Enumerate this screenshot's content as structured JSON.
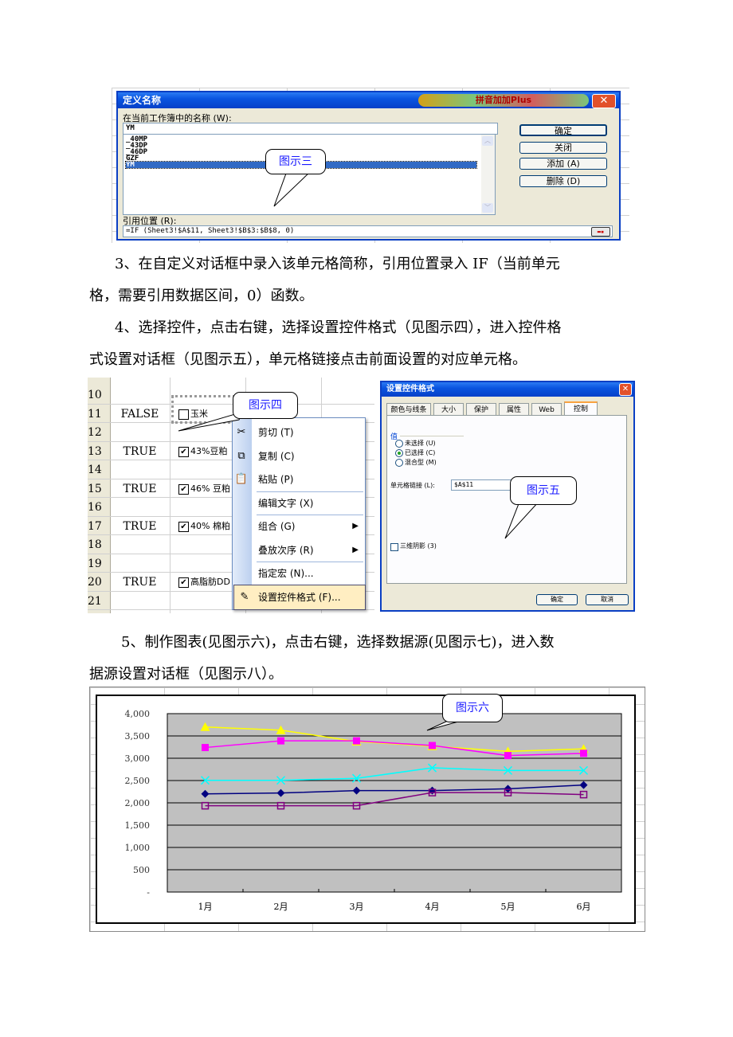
{
  "figure3_dialog": {
    "title": "定义名称",
    "title_logo": "拼音加加Plus",
    "close_icon": "close-icon",
    "names_label": "在当前工作簿中的名称 (W):",
    "name_input_value": "YM",
    "names_list": [
      "_40MP",
      "_43DP",
      "_46DP",
      "GZF",
      "YM"
    ],
    "selected_name": "YM",
    "buttons": {
      "ok": "确定",
      "close": "关闭",
      "add": "添加 (A)",
      "delete": "删除 (D)"
    },
    "refers_label": "引用位置 (R):",
    "refers_value": "=IF (Sheet3!$A$11, Sheet3!$B$3:$B$8, 0)",
    "collapse_icon": "range-select-icon",
    "callout": "图示三"
  },
  "paragraphs": {
    "p3_line1": "3、在自定义对话框中录入该单元格简称，引用位置录入 IF（当前单元",
    "p3_line2": "格，需要引用数据区间，0）函数。",
    "p4_line1": "4、选择控件，点击右键，选择设置控件格式（见图示四），进入控件格",
    "p4_line2": "式设置对话框（见图示五），单元格链接点击前面设置的对应单元格。",
    "p5_line1": "5、制作图表(见图示六)，点击右键，选择数据源(见图示七)，进入数",
    "p5_line2": "据源设置对话框（见图示八）。"
  },
  "figure4_sheet": {
    "rows": [
      {
        "num": "10",
        "a": "",
        "b": ""
      },
      {
        "num": "11",
        "a": "FALSE",
        "b": "玉米",
        "checked": false
      },
      {
        "num": "12",
        "a": "",
        "b": ""
      },
      {
        "num": "13",
        "a": "TRUE",
        "b": "43%豆粕",
        "checked": true
      },
      {
        "num": "14",
        "a": "",
        "b": ""
      },
      {
        "num": "15",
        "a": "TRUE",
        "b": "46% 豆粕",
        "checked": true
      },
      {
        "num": "16",
        "a": "",
        "b": ""
      },
      {
        "num": "17",
        "a": "TRUE",
        "b": "40% 棉粕",
        "checked": true
      },
      {
        "num": "18",
        "a": "",
        "b": ""
      },
      {
        "num": "19",
        "a": "",
        "b": ""
      },
      {
        "num": "20",
        "a": "TRUE",
        "b": "高脂肪DD",
        "checked": true
      },
      {
        "num": "21",
        "a": "",
        "b": ""
      }
    ],
    "callout": "图示四",
    "context_menu": [
      {
        "label": "剪切 (T)",
        "icon": "scissors-icon"
      },
      {
        "label": "复制 (C)",
        "icon": "copy-icon"
      },
      {
        "label": "粘贴 (P)",
        "icon": "paste-icon"
      },
      {
        "label": "编辑文字 (X)"
      },
      {
        "label": "组合 (G)",
        "submenu": true
      },
      {
        "label": "叠放次序 (R)",
        "submenu": true
      },
      {
        "label": "指定宏 (N)..."
      },
      {
        "label": "设置控件格式 (F)...",
        "icon": "format-control-icon",
        "highlighted": true
      }
    ]
  },
  "figure5_dialog": {
    "title": "设置控件格式",
    "tabs": [
      "颜色与线条",
      "大小",
      "保护",
      "属性",
      "Web",
      "控制"
    ],
    "active_tab": "控制",
    "value_group_label": "值",
    "radios": [
      {
        "label": "未选择 (U)",
        "checked": false
      },
      {
        "label": "已选择 (C)",
        "checked": true
      },
      {
        "label": "混合型 (M)",
        "checked": false
      }
    ],
    "cell_link_label": "单元格链接 (L):",
    "cell_link_value": "$A$11",
    "shading_label": "三维阴影 (3)",
    "shading_checked": false,
    "ok": "确定",
    "cancel": "取消",
    "callout": "图示五"
  },
  "chart_data": {
    "type": "line",
    "title": "",
    "callout": "图示六",
    "categories": [
      "1月",
      "2月",
      "3月",
      "4月",
      "5月",
      "6月"
    ],
    "ylim": [
      0,
      4000
    ],
    "yticks": [
      "-",
      "500",
      "1,000",
      "1,500",
      "2,000",
      "2,500",
      "3,000",
      "3,500",
      "4,000"
    ],
    "ytick_values": [
      0,
      500,
      1000,
      1500,
      2000,
      2500,
      3000,
      3500,
      4000
    ],
    "grid": true,
    "legend": "none",
    "series": [
      {
        "name": "series-yellow",
        "color": "#ffff00",
        "marker": "triangle",
        "values": [
          3700,
          3630,
          3375,
          3270,
          3155,
          3210
        ]
      },
      {
        "name": "series-magenta",
        "color": "#ff00ff",
        "marker": "square",
        "values": [
          3240,
          3390,
          3390,
          3285,
          3060,
          3110
        ]
      },
      {
        "name": "series-cyan",
        "color": "#00ffff",
        "marker": "x",
        "values": [
          2505,
          2505,
          2550,
          2785,
          2725,
          2725
        ]
      },
      {
        "name": "series-navy",
        "color": "#000080",
        "marker": "diamond",
        "values": [
          2200,
          2220,
          2275,
          2275,
          2315,
          2400
        ]
      },
      {
        "name": "series-purple",
        "color": "#800080",
        "marker": "open-square",
        "values": [
          1935,
          1935,
          1935,
          2230,
          2230,
          2185
        ]
      }
    ]
  }
}
